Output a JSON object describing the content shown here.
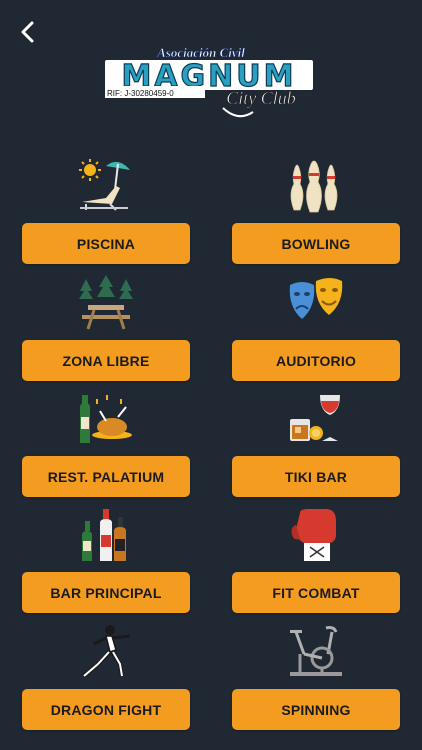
{
  "header": {
    "back_icon": "chevron-left-icon",
    "logo": {
      "line1": "Asociación Civil",
      "line2": "MAGNUM",
      "line3": "City Club",
      "rif": "RIF: J-30280459-0"
    }
  },
  "items": [
    {
      "label": "PISCINA",
      "icon": "beach-chair-icon"
    },
    {
      "label": "BOWLING",
      "icon": "bowling-pins-icon"
    },
    {
      "label": "ZONA LIBRE",
      "icon": "picnic-table-icon"
    },
    {
      "label": "AUDITORIO",
      "icon": "theater-masks-icon"
    },
    {
      "label": "REST. PALATIUM",
      "icon": "wine-chicken-icon"
    },
    {
      "label": "TIKI BAR",
      "icon": "cocktail-icon"
    },
    {
      "label": "BAR PRINCIPAL",
      "icon": "bottles-icon"
    },
    {
      "label": "FIT COMBAT",
      "icon": "boxing-glove-icon"
    },
    {
      "label": "DRAGON FIGHT",
      "icon": "martial-artist-icon"
    },
    {
      "label": "SPINNING",
      "icon": "stationary-bike-icon"
    }
  ],
  "colors": {
    "background": "#1f2833",
    "button": "#f39c1f"
  }
}
